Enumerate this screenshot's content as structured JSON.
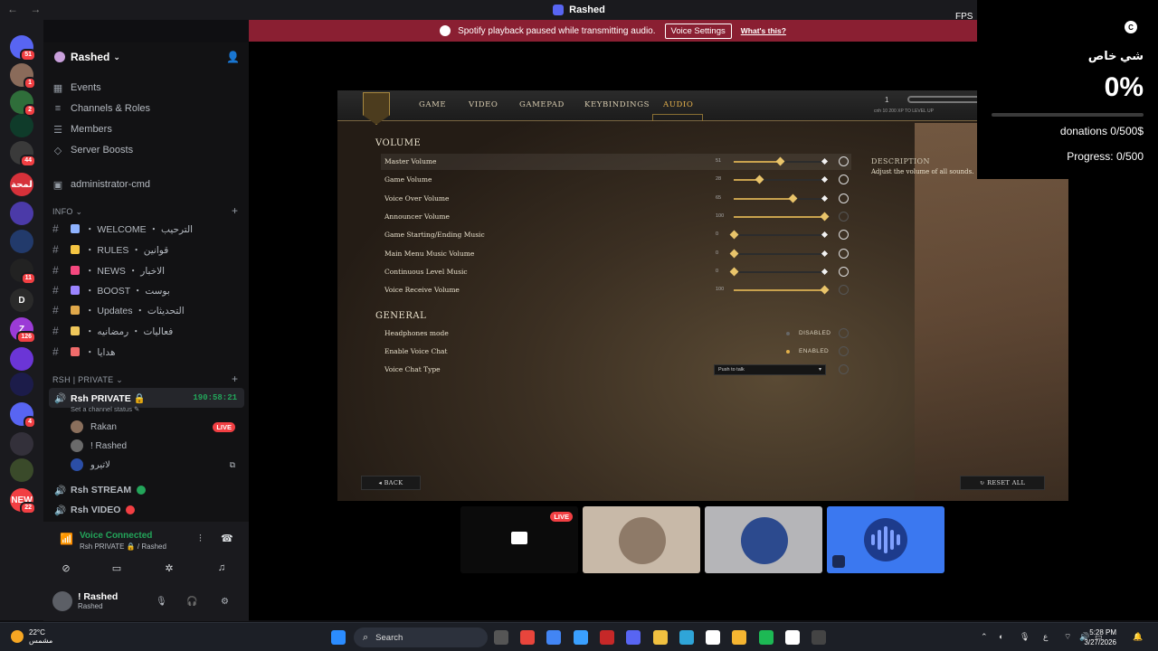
{
  "window": {
    "title": "Rashed",
    "back": "←",
    "forward": "→"
  },
  "notice": {
    "text": "Spotify playback paused while transmitting audio.",
    "button": "Voice Settings",
    "link": "What's this?"
  },
  "fps_label": "FPS",
  "rail": {
    "servers": [
      {
        "label": "",
        "badge": "51",
        "color": "#5865f2"
      },
      {
        "label": "",
        "badge": "1",
        "color": "#8a6b5a"
      },
      {
        "label": "",
        "badge": "2",
        "color": "#2f6e3a"
      },
      {
        "label": "",
        "badge": "",
        "color": "#0f3b2a"
      },
      {
        "label": "",
        "badge": "44",
        "color": "#3a3a3a"
      },
      {
        "label": "لمحة",
        "badge": "",
        "color": "#d6313a"
      },
      {
        "label": "",
        "badge": "",
        "color": "#4b3aa8"
      },
      {
        "label": "",
        "badge": "",
        "color": "#223a6b"
      },
      {
        "label": "",
        "badge": "11",
        "color": "#222"
      },
      {
        "label": "D",
        "badge": "",
        "color": "#2a2a2a"
      },
      {
        "label": "Z",
        "badge": "126",
        "color": "#9b3bd6"
      },
      {
        "label": "",
        "badge": "",
        "color": "#6b35d6"
      },
      {
        "label": "",
        "badge": "",
        "color": "#1c1c4a"
      },
      {
        "label": "",
        "badge": "4",
        "color": "#5865f2"
      },
      {
        "label": "",
        "badge": "",
        "color": "#33303a"
      },
      {
        "label": "",
        "badge": "",
        "color": "#3a4a2a"
      },
      {
        "label": "NEW",
        "badge": "22",
        "color": "#f23f43"
      }
    ]
  },
  "sidebar": {
    "guild_name": "Rashed",
    "nav": [
      {
        "label": "Events",
        "icon": "calendar-icon"
      },
      {
        "label": "Channels & Roles",
        "icon": "list-icon"
      },
      {
        "label": "Members",
        "icon": "members-icon"
      },
      {
        "label": "Server Boosts",
        "icon": "boost-icon"
      }
    ],
    "admin_channel": "administrator-cmd",
    "categories": {
      "info": "INFO",
      "private": "Rsh | PRIVATE"
    },
    "channels": [
      {
        "label": "・ WELCOME ・ الترحيب",
        "color": "#8fb3ff"
      },
      {
        "label": "・ RULES ・ قوانين",
        "color": "#f5c542"
      },
      {
        "label": "・ NEWS ・ الاخبار",
        "color": "#f5487f"
      },
      {
        "label": "・ BOOST ・ بوست",
        "color": "#9b84ff"
      },
      {
        "label": "・ Updates ・ التحديثات",
        "color": "#e0a84a"
      },
      {
        "label": "・ فعاليات ・ رمضانيه",
        "color": "#f0c75a"
      },
      {
        "label": "・ هدايا",
        "color": "#f06b6b"
      }
    ],
    "voice_channel": {
      "label": "Rsh PRIVATE 🔒",
      "timer": "190:58:21",
      "status": "Set a channel status ✎"
    },
    "voice_users": [
      {
        "name": "Rakan",
        "live": "LIVE"
      },
      {
        "name": "! Rashed",
        "live": ""
      },
      {
        "name": "لاتيرو",
        "live": ""
      }
    ],
    "other_channels": [
      {
        "label": "Rsh STREAM",
        "dot": "#23a55a"
      },
      {
        "label": "Rsh VIDEO",
        "dot": "#f23f43"
      }
    ],
    "voice_connected": {
      "title": "Voice Connected",
      "sub": "Rsh PRIVATE 🔒 / Rashed"
    },
    "user": {
      "name": "! Rashed",
      "status": "Rashed"
    }
  },
  "game": {
    "tabs": [
      "GAME",
      "VIDEO",
      "GAMEPAD",
      "KEYBINDINGS",
      "AUDIO"
    ],
    "active_tab": "AUDIO",
    "level": "1",
    "xp_text": "cnh 10    200 XP TO LEVEL UP",
    "volume_title": "VOLUME",
    "sliders": [
      {
        "label": "Master Volume",
        "value": "51",
        "fraction": 0.51,
        "reset_active": true
      },
      {
        "label": "Game Volume",
        "value": "28",
        "fraction": 0.28,
        "reset_active": true
      },
      {
        "label": "Voice Over Volume",
        "value": "65",
        "fraction": 0.65,
        "reset_active": true
      },
      {
        "label": "Announcer Volume",
        "value": "100",
        "fraction": 1.0,
        "reset_active": false
      },
      {
        "label": "Game Starting/Ending Music",
        "value": "0",
        "fraction": 0.0,
        "reset_active": true
      },
      {
        "label": "Main Menu Music Volume",
        "value": "0",
        "fraction": 0.0,
        "reset_active": true
      },
      {
        "label": "Continuous Level Music",
        "value": "0",
        "fraction": 0.0,
        "reset_active": true
      },
      {
        "label": "Voice Receive Volume",
        "value": "100",
        "fraction": 1.0,
        "reset_active": false
      }
    ],
    "general_title": "GENERAL",
    "general": [
      {
        "label": "Headphones mode",
        "option": "DISABLED",
        "on": false
      },
      {
        "label": "Enable Voice Chat",
        "option": "ENABLED",
        "on": true
      },
      {
        "label": "Voice Chat Type",
        "select": "Push to talk"
      }
    ],
    "description_title": "DESCRIPTION",
    "description_text": "Adjust the volume of all sounds.",
    "back": "BACK",
    "reset_all": "RESET ALL"
  },
  "tiles": [
    {
      "kind": "stream",
      "live": "LIVE",
      "bg": "#0b0b0b"
    },
    {
      "kind": "avatar",
      "bg": "#c8b9a8",
      "face": "#8e7a68"
    },
    {
      "kind": "avatar",
      "bg": "#b5b5b8",
      "face": "#2c4a8e"
    },
    {
      "kind": "speaking",
      "bg": "#3b78f0"
    }
  ],
  "overlay": {
    "badge": "C",
    "title": "شي خاص",
    "percent": "0%",
    "progress_fraction": 0.0,
    "donations": "donations 0/500$",
    "progress": "Progress: 0/500"
  },
  "taskbar": {
    "temp": "22°C",
    "weather": "مشمس",
    "search": "Search",
    "lang": "ع",
    "time": "5:28 PM",
    "date": "3/27/2026",
    "apps": [
      {
        "name": "chrome-icon",
        "color": "#e8453c"
      },
      {
        "name": "chrome-alt-icon",
        "color": "#4285f4"
      },
      {
        "name": "copilot-icon",
        "color": "#3aa0ff"
      },
      {
        "name": "acrobat-icon",
        "color": "#c62828"
      },
      {
        "name": "discord-icon",
        "color": "#5865f2"
      },
      {
        "name": "explorer-icon",
        "color": "#f0c040"
      },
      {
        "name": "edge-icon",
        "color": "#2fa5d8"
      },
      {
        "name": "store-icon",
        "color": "#ffffff"
      },
      {
        "name": "app-icon",
        "color": "#f5b531"
      },
      {
        "name": "spotify-icon",
        "color": "#1db954"
      },
      {
        "name": "roblox-icon",
        "color": "#ffffff"
      },
      {
        "name": "obs-icon",
        "color": "#444444"
      }
    ]
  }
}
